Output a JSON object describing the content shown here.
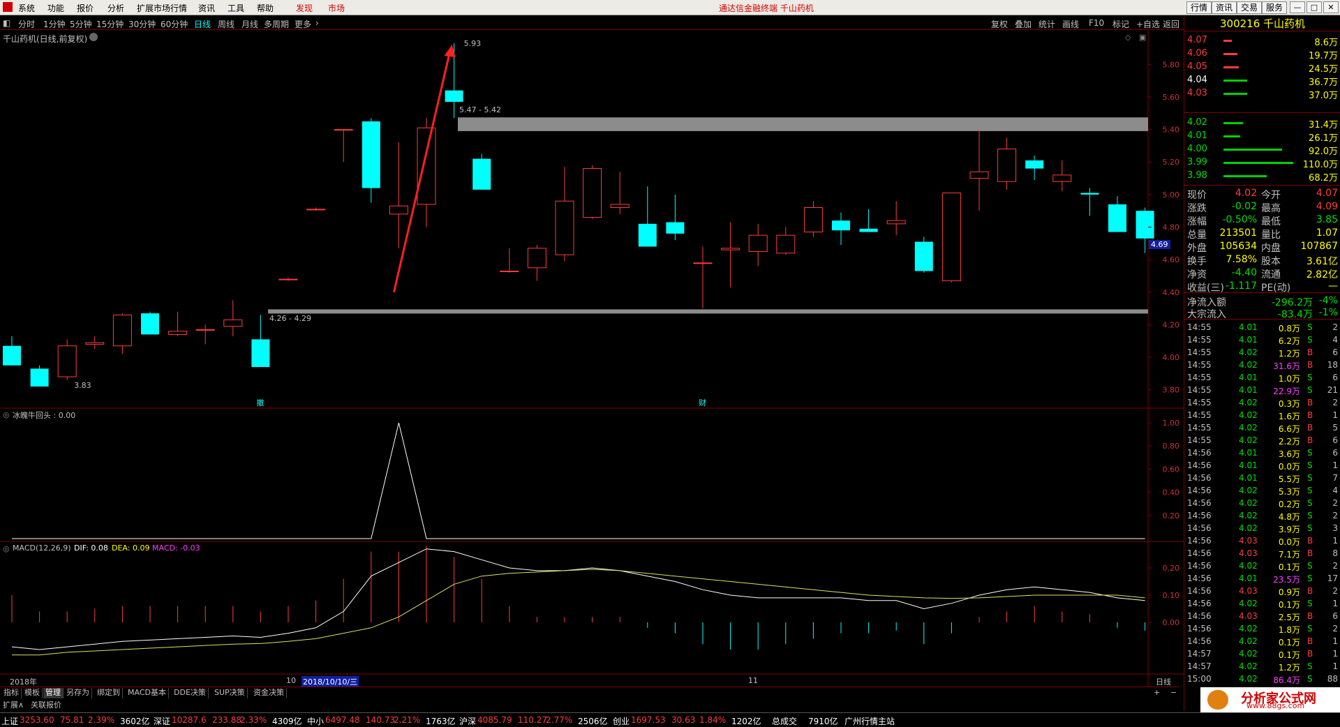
{
  "app_title": "通达信金融终端  千山药机",
  "menu": [
    "系统",
    "功能",
    "报价",
    "分析",
    "扩展市场行情",
    "资讯",
    "工具",
    "帮助"
  ],
  "menu_red": [
    "发现",
    "市场"
  ],
  "top_tabs": [
    "行情",
    "资讯",
    "交易",
    "服务"
  ],
  "window_buttons": [
    "—",
    "□",
    "✕"
  ],
  "periods": [
    "分时",
    "1分钟",
    "5分钟",
    "15分钟",
    "30分钟",
    "60分钟",
    "日线",
    "周线",
    "月线",
    "多周期",
    "更多"
  ],
  "active_period": "日线",
  "toolbar_right": [
    "复权",
    "叠加",
    "统计",
    "画线",
    "F10",
    "标记",
    "+自选",
    "返回"
  ],
  "chart": {
    "title": "千山药机(日线,前复权)",
    "price_labels": [
      "5.80",
      "5.60",
      "5.40",
      "5.20",
      "5.00",
      "4.80",
      "4.60",
      "4.40",
      "4.20",
      "4.00",
      "3.80"
    ],
    "current_price_tag": "4.69",
    "high_annotation": "5.93",
    "low_annotation": "3.83",
    "zone_upper_label": "5.47 - 5.42",
    "zone_lower_label": "4.26 - 4.29",
    "event_marker_1": "撤",
    "event_marker_2": "财"
  },
  "chart_data": {
    "type": "candlestick",
    "ohlc": [
      [
        4.07,
        4.13,
        3.95,
        3.95
      ],
      [
        3.93,
        3.95,
        3.85,
        3.82
      ],
      [
        3.88,
        4.11,
        3.86,
        4.07
      ],
      [
        4.08,
        4.13,
        4.05,
        4.09
      ],
      [
        4.07,
        4.27,
        4.02,
        4.26
      ],
      [
        4.27,
        4.28,
        4.22,
        4.14
      ],
      [
        4.14,
        4.28,
        4.13,
        4.16
      ],
      [
        4.17,
        4.2,
        4.08,
        4.17
      ],
      [
        4.19,
        4.35,
        4.13,
        4.23
      ],
      [
        4.11,
        4.26,
        3.95,
        3.94
      ],
      [
        4.48,
        4.49,
        4.47,
        4.48
      ],
      [
        4.91,
        4.92,
        4.9,
        4.91
      ],
      [
        5.4,
        5.4,
        5.2,
        5.4
      ],
      [
        5.45,
        5.47,
        4.95,
        5.04
      ],
      [
        4.88,
        5.32,
        4.67,
        4.93
      ],
      [
        4.94,
        5.47,
        4.8,
        5.41
      ],
      [
        5.64,
        5.93,
        5.47,
        5.57
      ],
      [
        5.22,
        5.25,
        5.03,
        5.03
      ],
      [
        4.53,
        4.67,
        4.52,
        4.53
      ],
      [
        4.55,
        4.69,
        4.47,
        4.67
      ],
      [
        4.63,
        5.17,
        4.59,
        4.96
      ],
      [
        4.86,
        5.18,
        4.85,
        5.16
      ],
      [
        4.92,
        5.14,
        4.88,
        4.94
      ],
      [
        4.82,
        5.05,
        4.68,
        4.68
      ],
      [
        4.83,
        5.0,
        4.72,
        4.76
      ],
      [
        4.58,
        4.68,
        4.3,
        4.58
      ],
      [
        4.66,
        4.83,
        4.43,
        4.67
      ],
      [
        4.65,
        4.82,
        4.56,
        4.75
      ],
      [
        4.64,
        4.8,
        4.63,
        4.75
      ],
      [
        4.77,
        4.96,
        4.74,
        4.92
      ],
      [
        4.84,
        4.89,
        4.69,
        4.78
      ],
      [
        4.79,
        4.91,
        4.78,
        4.77
      ],
      [
        4.82,
        4.96,
        4.75,
        4.84
      ],
      [
        4.71,
        4.74,
        4.52,
        4.53
      ],
      [
        4.47,
        5.01,
        4.46,
        5.01
      ],
      [
        5.1,
        5.4,
        4.9,
        5.14
      ],
      [
        5.08,
        5.35,
        5.03,
        5.28
      ],
      [
        5.21,
        5.24,
        5.09,
        5.16
      ],
      [
        5.08,
        5.21,
        5.02,
        5.12
      ],
      [
        5.01,
        5.04,
        4.87,
        5.0
      ],
      [
        4.94,
        4.99,
        4.78,
        4.77
      ],
      [
        4.9,
        4.92,
        4.64,
        4.73
      ]
    ],
    "price_range": [
      3.73,
      5.93
    ],
    "indicator1": {
      "label": "冰魄牛回头 : 0.00",
      "ticks": [
        "1.00",
        "0.80",
        "0.60",
        "0.40",
        "0.20"
      ],
      "values": [
        0,
        0,
        0,
        0,
        0,
        0,
        0,
        0,
        0,
        0,
        0,
        0,
        0,
        0,
        1,
        0,
        0,
        0,
        0,
        0,
        0,
        0,
        0,
        0,
        0,
        0,
        0,
        0,
        0,
        0,
        0,
        0,
        0,
        0,
        0,
        0,
        0,
        0,
        0,
        0,
        0,
        0
      ]
    },
    "macd": {
      "label": "MACD(12,26,9)",
      "dif_label": "DIF: 0.08",
      "dea_label": "DEA: 0.09",
      "macd_label": "MACD: -0.03",
      "ticks": [
        "0.20",
        "0.10",
        "0.00"
      ],
      "dif": [
        -0.09,
        -0.1,
        -0.09,
        -0.08,
        -0.07,
        -0.065,
        -0.06,
        -0.055,
        -0.05,
        -0.055,
        -0.04,
        -0.02,
        0.04,
        0.17,
        0.22,
        0.27,
        0.26,
        0.23,
        0.2,
        0.19,
        0.19,
        0.2,
        0.19,
        0.17,
        0.15,
        0.12,
        0.1,
        0.09,
        0.09,
        0.09,
        0.09,
        0.08,
        0.08,
        0.05,
        0.07,
        0.1,
        0.12,
        0.13,
        0.12,
        0.11,
        0.09,
        0.08
      ],
      "dea": [
        -0.12,
        -0.12,
        -0.11,
        -0.105,
        -0.1,
        -0.095,
        -0.09,
        -0.085,
        -0.08,
        -0.078,
        -0.07,
        -0.06,
        -0.04,
        -0.02,
        0.02,
        0.08,
        0.14,
        0.17,
        0.18,
        0.185,
        0.19,
        0.195,
        0.19,
        0.18,
        0.17,
        0.16,
        0.15,
        0.14,
        0.13,
        0.12,
        0.11,
        0.1,
        0.095,
        0.09,
        0.088,
        0.09,
        0.095,
        0.1,
        0.1,
        0.1,
        0.1,
        0.09
      ],
      "hist": [
        0.1,
        0.04,
        0.04,
        0.05,
        0.06,
        0.06,
        0.06,
        0.06,
        0.06,
        0.04,
        0.06,
        0.08,
        0.16,
        0.26,
        0.26,
        0.28,
        0.24,
        0.16,
        0.06,
        0.02,
        0.02,
        0.02,
        0.02,
        -0.02,
        -0.04,
        -0.08,
        -0.1,
        -0.1,
        -0.08,
        -0.06,
        -0.04,
        -0.04,
        -0.03,
        -0.08,
        -0.04,
        0.02,
        0.04,
        0.06,
        0.04,
        0.03,
        -0.02,
        -0.03
      ]
    }
  },
  "xaxis": {
    "year": "2018年",
    "m10": "10",
    "date_hl": "2018/10/10/三",
    "m11": "11",
    "period": "日线"
  },
  "bottom_tabs": [
    "指标",
    "模板",
    "管理",
    "另存为",
    "绑定到",
    "MACD基本",
    "DDE决策",
    "SUP决策",
    "资金决策"
  ],
  "bottom_tabs2": [
    "扩展∧",
    "关联报价"
  ],
  "right_panel": {
    "code_name": "300216 千山药机",
    "asks": [
      {
        "price": "4.07",
        "vol": "8.6万",
        "w": 12
      },
      {
        "price": "4.06",
        "vol": "19.7万",
        "w": 20
      },
      {
        "price": "4.05",
        "vol": "24.5万",
        "w": 22
      },
      {
        "price": "4.04",
        "vol": "36.7万",
        "w": 34
      },
      {
        "price": "4.03",
        "vol": "37.0万",
        "w": 34
      }
    ],
    "bids": [
      {
        "price": "4.02",
        "vol": "31.4万",
        "w": 28
      },
      {
        "price": "4.01",
        "vol": "26.1万",
        "w": 24
      },
      {
        "price": "4.00",
        "vol": "92.0万",
        "w": 84
      },
      {
        "price": "3.99",
        "vol": "110.0万",
        "w": 100
      },
      {
        "price": "3.98",
        "vol": "68.2万",
        "w": 62
      }
    ],
    "quotes": [
      [
        "现价",
        "4.02",
        "今开",
        "4.07"
      ],
      [
        "涨跌",
        "-0.02",
        "最高",
        "4.09"
      ],
      [
        "涨幅",
        "-0.50%",
        "最低",
        "3.85"
      ],
      [
        "总量",
        "213501",
        "量比",
        "1.07"
      ],
      [
        "外盘",
        "105634",
        "内盘",
        "107867"
      ],
      [
        "换手",
        "7.58%",
        "股本",
        "3.61亿"
      ],
      [
        "净资",
        "-4.40",
        "流通",
        "2.82亿"
      ],
      [
        "收益(三)",
        "-1.117",
        "PE(动)",
        "—"
      ]
    ],
    "flows": [
      [
        "净流入额",
        "-296.2万",
        "-4%"
      ],
      [
        "大宗流入",
        "-83.4万",
        "-1%"
      ]
    ],
    "ticks": [
      [
        "14:55",
        "4.01",
        "0.8万",
        "S",
        "2"
      ],
      [
        "14:55",
        "4.01",
        "6.2万",
        "S",
        "4"
      ],
      [
        "14:55",
        "4.02",
        "1.2万",
        "B",
        "6"
      ],
      [
        "14:55",
        "4.02",
        "31.6万",
        "B",
        "18"
      ],
      [
        "14:55",
        "4.01",
        "1.0万",
        "S",
        "6"
      ],
      [
        "14:55",
        "4.01",
        "22.9万",
        "S",
        "21"
      ],
      [
        "14:55",
        "4.02",
        "0.3万",
        "B",
        "2"
      ],
      [
        "14:55",
        "4.02",
        "1.6万",
        "B",
        "1"
      ],
      [
        "14:55",
        "4.02",
        "6.6万",
        "B",
        "5"
      ],
      [
        "14:55",
        "4.02",
        "2.2万",
        "B",
        "6"
      ],
      [
        "14:56",
        "4.01",
        "3.6万",
        "S",
        "6"
      ],
      [
        "14:56",
        "4.01",
        "0.0万",
        "S",
        "1"
      ],
      [
        "14:56",
        "4.01",
        "5.5万",
        "S",
        "7"
      ],
      [
        "14:56",
        "4.02",
        "5.3万",
        "S",
        "4"
      ],
      [
        "14:56",
        "4.02",
        "0.2万",
        "S",
        "2"
      ],
      [
        "14:56",
        "4.02",
        "4.8万",
        "S",
        "2"
      ],
      [
        "14:56",
        "4.02",
        "3.9万",
        "S",
        "3"
      ],
      [
        "14:56",
        "4.03",
        "0.0万",
        "B",
        "1"
      ],
      [
        "14:56",
        "4.03",
        "7.1万",
        "B",
        "8"
      ],
      [
        "14:56",
        "4.02",
        "0.1万",
        "S",
        "2"
      ],
      [
        "14:56",
        "4.01",
        "23.5万",
        "S",
        "17"
      ],
      [
        "14:56",
        "4.03",
        "0.9万",
        "B",
        "2"
      ],
      [
        "14:56",
        "4.02",
        "0.1万",
        "S",
        "1"
      ],
      [
        "14:56",
        "4.03",
        "2.5万",
        "B",
        "6"
      ],
      [
        "14:56",
        "4.02",
        "1.8万",
        "S",
        "2"
      ],
      [
        "14:56",
        "4.02",
        "0.1万",
        "B",
        "1"
      ],
      [
        "14:57",
        "4.02",
        "0.1万",
        "B",
        "1"
      ],
      [
        "14:57",
        "4.02",
        "1.2万",
        "S",
        "1"
      ],
      [
        "15:00",
        "4.02",
        "86.4万",
        "S",
        "88"
      ]
    ]
  },
  "status": [
    {
      "name": "上证",
      "val": "3253.60",
      "chg": "75.81",
      "pct": "2.39%",
      "amt": "3602亿"
    },
    {
      "name": "深证",
      "val": "10287.6",
      "chg": "233.88",
      "pct": "2.33%",
      "amt": "4309亿"
    },
    {
      "name": "中小",
      "val": "6497.48",
      "chg": "140.73",
      "pct": "2.21%",
      "amt": "1763亿"
    },
    {
      "name": "沪深",
      "val": "4085.79",
      "chg": "110.27",
      "pct": "2.77%",
      "amt": "2506亿"
    },
    {
      "name": "创业",
      "val": "1697.53",
      "chg": "30.63",
      "pct": "1.84%",
      "amt": "1202亿"
    }
  ],
  "status_extra": {
    "total_label": "总成交",
    "total_val": "7910亿",
    "server": "广州行情主站"
  },
  "logo": {
    "line1": "分析家公式网",
    "line2": "www.88gs.com"
  },
  "colors": {
    "up": "#ff3c3c",
    "down": "#00ffff",
    "dif": "#ffffff",
    "dea": "#e0e060",
    "zone": "#8c8c8c",
    "arrow": "#ff2020"
  }
}
